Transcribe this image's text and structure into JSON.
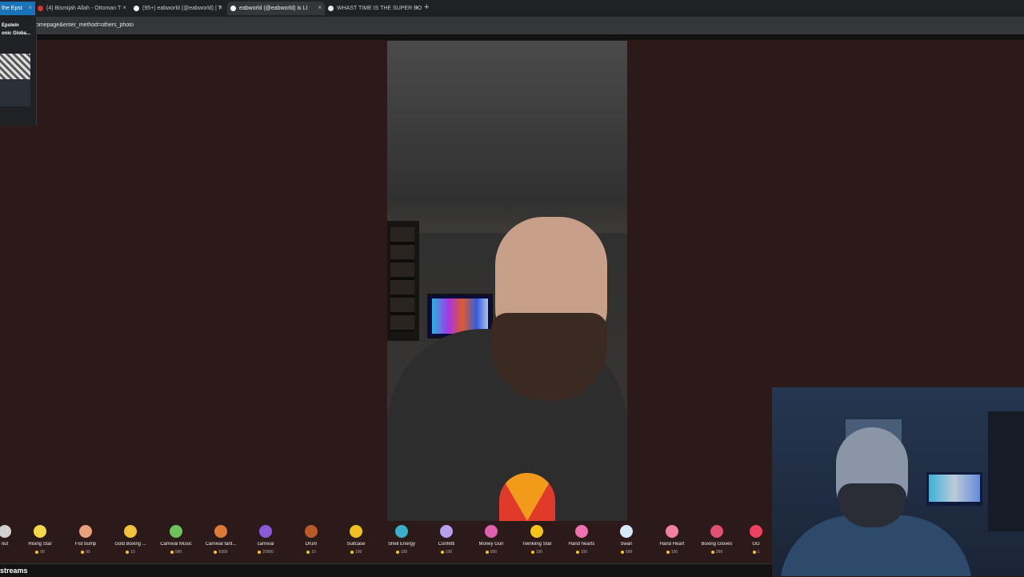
{
  "browser": {
    "tabs": [
      {
        "label": "the Epst",
        "state": "first"
      },
      {
        "label": "(4) Bismijah Allah - Ottoman T",
        "state": "normal",
        "favicon_color": "#e0322e"
      },
      {
        "label": "(95+) eabworld (@eabworld) | T",
        "state": "normal",
        "favicon_color": "#ffffff"
      },
      {
        "label": "eabworld (@eabworld) is LI",
        "state": "active",
        "favicon_color": "#ffffff"
      },
      {
        "label": "WHAST TIME IS THE SUPER BO",
        "state": "normal",
        "favicon_color": "#e8e8e8"
      }
    ],
    "close_glyph": "×",
    "new_tab_glyph": "+",
    "url": "omepage&enter_method=others_photo"
  },
  "popup": {
    "line1": "Epstein",
    "line2": "onic Globa..."
  },
  "gifts": [
    {
      "name": "nut",
      "price": ""
    },
    {
      "name": "Rising Star",
      "price": "99",
      "color": "#f5d94a"
    },
    {
      "name": "Fist bump",
      "price": "90",
      "color": "#e8a07a"
    },
    {
      "name": "Gold Boxing ...",
      "price": "10",
      "color": "#f2c23a"
    },
    {
      "name": "Carnival Music",
      "price": "999",
      "color": "#6fc25a"
    },
    {
      "name": "Carnival fant...",
      "price": "6999",
      "color": "#e07a3a"
    },
    {
      "name": "carnival",
      "price": "20000",
      "color": "#8a5ad8"
    },
    {
      "name": "Drum",
      "price": "10",
      "color": "#b85a2a"
    },
    {
      "name": "Suitcase",
      "price": "199",
      "color": "#f0c020"
    },
    {
      "name": "Shell Energy",
      "price": "100",
      "color": "#3ab0c8"
    },
    {
      "name": "Confetti",
      "price": "100",
      "color": "#b8a0f0"
    },
    {
      "name": "Money Gun",
      "price": "500",
      "color": "#e060b0"
    },
    {
      "name": "Twinkling Star",
      "price": "100",
      "color": "#f5c518"
    },
    {
      "name": "Hand hearts",
      "price": "100",
      "color": "#f070b0"
    },
    {
      "name": "Swan",
      "price": "699",
      "color": "#d8e8ff"
    },
    {
      "name": "Hand Heart",
      "price": "100",
      "color": "#f080a0"
    },
    {
      "name": "Boxing Gloves",
      "price": "299",
      "color": "#e05070"
    },
    {
      "name": "GG",
      "price": "1",
      "color": "#f04060"
    }
  ],
  "bottom": {
    "label": "streams"
  }
}
